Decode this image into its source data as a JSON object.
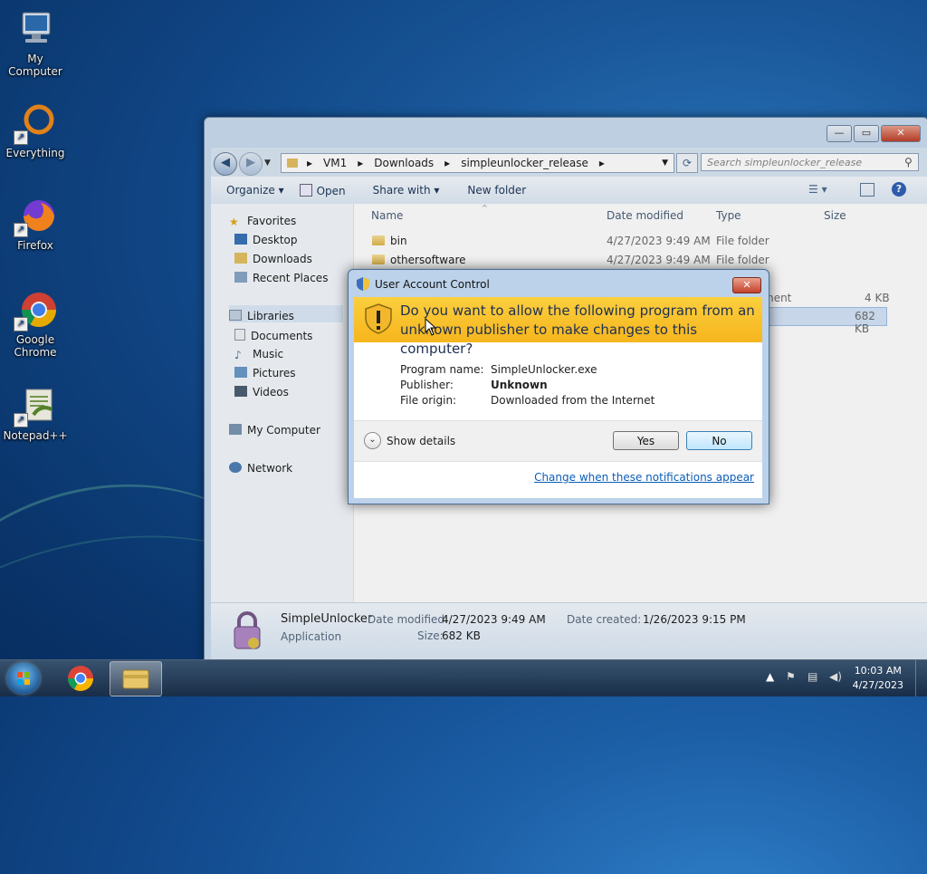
{
  "desktop": {
    "icons": [
      {
        "label": "My Computer",
        "icon": "computer-icon"
      },
      {
        "label": "Everything",
        "icon": "everything-icon"
      },
      {
        "label": "Firefox",
        "icon": "firefox-icon"
      },
      {
        "label": "Google Chrome",
        "icon": "chrome-icon"
      },
      {
        "label": "Notepad++",
        "icon": "notepadpp-icon"
      }
    ]
  },
  "explorer": {
    "address": {
      "crumbs": [
        "VM1",
        "Downloads",
        "simpleunlocker_release"
      ],
      "search_placeholder": "Search simpleunlocker_release"
    },
    "toolbar": {
      "organize": "Organize",
      "open": "Open",
      "share_with": "Share with",
      "new_folder": "New folder"
    },
    "nav": {
      "favorites": "Favorites",
      "desktop": "Desktop",
      "downloads": "Downloads",
      "recent_places": "Recent Places",
      "libraries": "Libraries",
      "documents": "Documents",
      "music": "Music",
      "pictures": "Pictures",
      "videos": "Videos",
      "my_computer": "My Computer",
      "network": "Network"
    },
    "columns": {
      "name": "Name",
      "date_modified": "Date modified",
      "type": "Type",
      "size": "Size"
    },
    "rows": [
      {
        "name": "bin",
        "date": "4/27/2023 9:49 AM",
        "type": "File folder",
        "size": ""
      },
      {
        "name": "othersoftware",
        "date": "4/27/2023 9:49 AM",
        "type": "File folder",
        "size": ""
      },
      {
        "name": "",
        "date": "",
        "type": "ment",
        "size": "4 KB"
      },
      {
        "name": "",
        "date": "",
        "type": "",
        "size": "682 KB"
      }
    ],
    "details": {
      "file_name": "SimpleUnlocker",
      "file_type": "Application",
      "date_modified_label": "Date modified:",
      "date_modified": "4/27/2023 9:49 AM",
      "size_label": "Size:",
      "size": "682 KB",
      "date_created_label": "Date created:",
      "date_created": "1/26/2023 9:15 PM"
    }
  },
  "uac": {
    "title": "User Account Control",
    "question": "Do you want to allow the following program from an unknown publisher to make changes to this computer?",
    "program_name_label": "Program name:",
    "program_name": "SimpleUnlocker.exe",
    "publisher_label": "Publisher:",
    "publisher": "Unknown",
    "file_origin_label": "File origin:",
    "file_origin": "Downloaded from the Internet",
    "show_details": "Show details",
    "yes": "Yes",
    "no": "No",
    "change_link": "Change when these notifications appear"
  },
  "taskbar": {
    "time": "10:03 AM",
    "date": "4/27/2023"
  },
  "colors": {
    "uac_banner": "#f6b51d",
    "link": "#0a5db8"
  }
}
